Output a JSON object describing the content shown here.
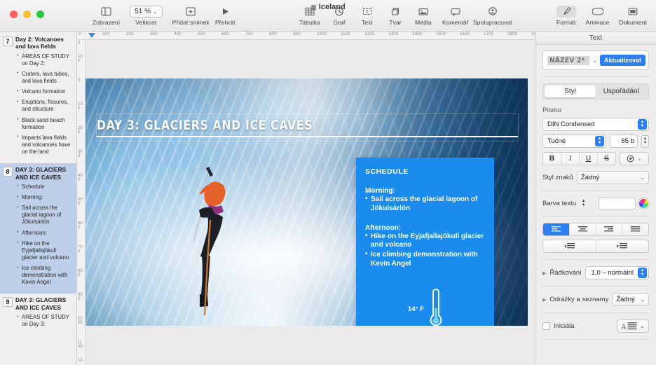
{
  "window": {
    "document_title": "Iceland",
    "traffic_lights": [
      "close",
      "minimize",
      "zoom"
    ]
  },
  "toolbar": {
    "view_label": "Zobrazení",
    "size_label": "Velikost",
    "zoom_value": "51 %",
    "add_slide_label": "Přidat snímek",
    "play_label": "Přehrát",
    "table_label": "Tabulka",
    "chart_label": "Graf",
    "text_label": "Text",
    "shape_label": "Tvar",
    "media_label": "Média",
    "comment_label": "Komentář",
    "collaborate_label": "Spolupracovat",
    "format_label": "Formát",
    "animate_label": "Animace",
    "document_label": "Dokument"
  },
  "navigator": {
    "slides": [
      {
        "number": "7",
        "title": "Day 2: Volcanoes and lava fields",
        "selected": false,
        "bullets": [
          "AREAS OF STUDY on Day 2:",
          "",
          "Craters, lava tubes, and lava fields",
          "Volcano formation",
          "Eruptions, fissures, and structure",
          "Black sand beach formation",
          "Impacts lava fields and volcanoes have on the land"
        ]
      },
      {
        "number": "8",
        "title": "DAY 3: GLACIERS AND ICE CAVES",
        "selected": true,
        "bullets": [
          "Schedule",
          "",
          "Morning:",
          "Sail across the glacial lagoon of Jökulsárlón",
          "",
          "Afternoon:",
          "Hike on the Eyjafjallajökull glacier and volcano",
          "Ice climbing demonstration with Kevin Angel"
        ]
      },
      {
        "number": "9",
        "title": "DAY 3: GLACIERS AND ICE CAVES",
        "selected": false,
        "bullets": [
          "AREAS OF STUDY on Day 3:"
        ]
      }
    ]
  },
  "ruler": {
    "horizontal_ticks": [
      "0",
      "100",
      "200",
      "300",
      "400",
      "500",
      "600",
      "700",
      "800",
      "900",
      "1000",
      "1100",
      "1200",
      "1300",
      "1400",
      "1500",
      "1600",
      "1700",
      "1800",
      "19"
    ],
    "vertical_ticks": [
      "0",
      "100",
      "0",
      "100",
      "200",
      "300",
      "400",
      "500",
      "600",
      "700",
      "800",
      "900",
      "1000",
      "1100",
      "12"
    ]
  },
  "slide": {
    "title": "DAY 3: GLACIERS AND ICE CAVES",
    "schedule": {
      "heading": "SCHEDULE",
      "morning_label": "Morning:",
      "morning_items": [
        "Sail across the glacial lagoon of Jökulsárlón"
      ],
      "afternoon_label": "Afternoon:",
      "afternoon_items": [
        "Hike on the Eyjafjallajökull glacier and volcano",
        "Ice climbing demonstration with Kevin Angel"
      ]
    },
    "temperature": "14° F",
    "accent_color": "#1a8cf0"
  },
  "format_panel": {
    "tab_title": "Text",
    "paragraph_style": "NÁZEV 2*",
    "update_button": "Aktualizovat",
    "tabs": [
      {
        "label": "Styl",
        "active": true
      },
      {
        "label": "Uspořádání",
        "active": false
      }
    ],
    "font_section_label": "Písmo",
    "font_family": "DIN Condensed",
    "font_weight": "Tučné",
    "font_size": "65 b",
    "style_buttons": [
      "B",
      "I",
      "U",
      "S"
    ],
    "character_style_label": "Styl znaků",
    "character_style_value": "Žádný",
    "text_color_label": "Barva textu",
    "alignment": [
      "align-left",
      "align-center",
      "align-right",
      "align-justify"
    ],
    "alignment_active": 0,
    "indent_buttons": [
      "outdent",
      "indent"
    ],
    "line_spacing_label": "Řádkování",
    "line_spacing_value": "1,0 – normální",
    "bullets_label": "Odrážky a seznamy",
    "bullets_value": "Žádný",
    "dropcap_label": "Iniciála",
    "dropcap_checked": false
  },
  "colors": {
    "accent_blue": "#2b7ff5",
    "slide_card_blue": "#1a8cf0",
    "selection_lavender": "#bdcfea"
  }
}
